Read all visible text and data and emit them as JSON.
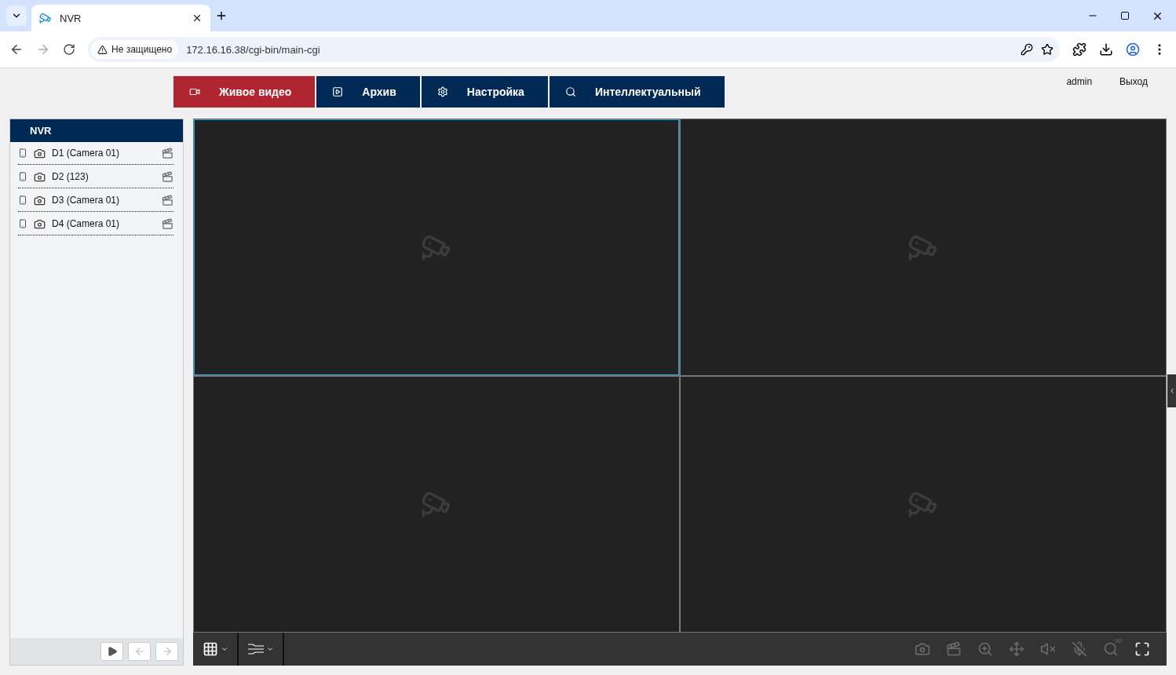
{
  "browser": {
    "tab_title": "NVR",
    "security": "Не защищено",
    "url": "172.16.16.38/cgi-bin/main-cgi"
  },
  "nav": [
    {
      "label": "Живое видео",
      "selected": true
    },
    {
      "label": "Архив",
      "selected": false
    },
    {
      "label": "Настройка",
      "selected": false
    },
    {
      "label": "Интеллектуальный",
      "selected": false
    }
  ],
  "user": "admin",
  "logout": "Выход",
  "sidebar": {
    "title": "NVR",
    "channels": [
      {
        "label": "D1 (Camera 01)"
      },
      {
        "label": "D2 (123)"
      },
      {
        "label": "D3 (Camera 01)"
      },
      {
        "label": "D4 (Camera 01)"
      }
    ],
    "controls": [
      {
        "disabled": false
      },
      {
        "disabled": true
      },
      {
        "disabled": true
      }
    ]
  },
  "tiles": [
    {
      "selected": true
    },
    {
      "selected": false
    },
    {
      "selected": false
    },
    {
      "selected": false
    }
  ],
  "toolbar": [
    {
      "disabled": true
    },
    {
      "disabled": true
    },
    {
      "disabled": true
    },
    {
      "disabled": true
    },
    {
      "disabled": true
    },
    {
      "disabled": true
    },
    {
      "disabled": true,
      "label": "3D"
    },
    {
      "disabled": false
    }
  ]
}
